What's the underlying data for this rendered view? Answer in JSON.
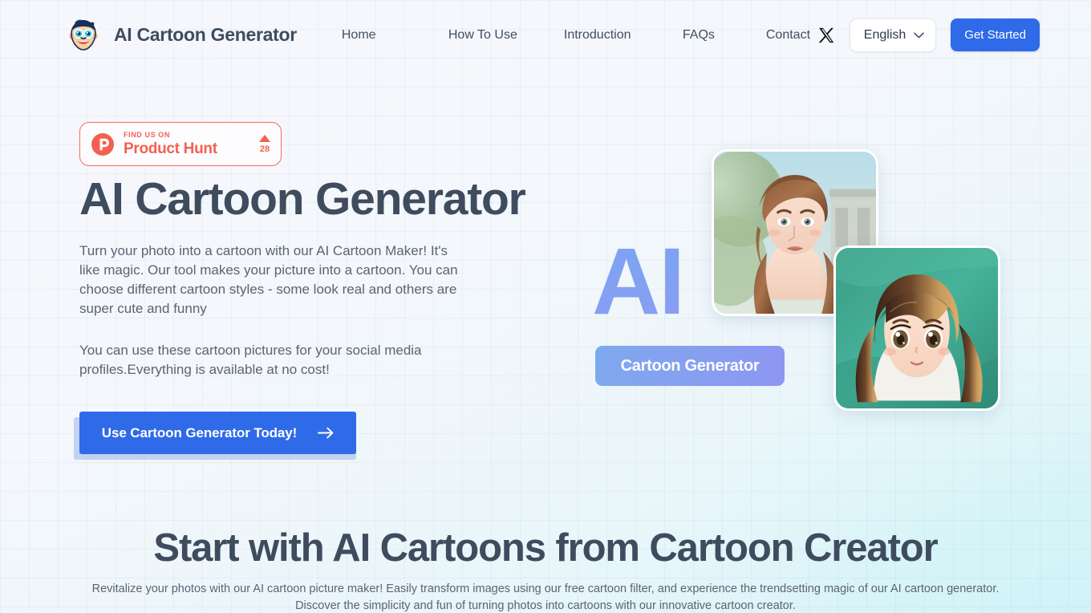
{
  "header": {
    "brand_name": "AI Cartoon Generator",
    "logo_icon": "cartoon-face-logo-icon",
    "nav": [
      {
        "label": "Home"
      },
      {
        "label": "How To Use"
      },
      {
        "label": "Introduction"
      },
      {
        "label": "FAQs"
      },
      {
        "label": "Contact"
      }
    ],
    "social_icon": "x-twitter-icon",
    "language": {
      "selected": "English",
      "chevron_icon": "chevron-down-icon"
    },
    "get_started_label": "Get Started"
  },
  "hero": {
    "product_hunt": {
      "logo_icon": "product-hunt-logo-icon",
      "find_us_on": "FIND US ON",
      "name": "Product Hunt",
      "upvote_icon": "triangle-up-icon",
      "votes": "28"
    },
    "title": "AI Cartoon Generator",
    "paragraph_1": "Turn your photo into a cartoon with our AI Cartoon Maker! It's like magic. Our tool makes your picture into a cartoon. You can choose different cartoon styles - some look real and others are super cute and funny",
    "paragraph_2": "You can use these cartoon pictures for your social media profiles.Everything is available at no cost!",
    "cta_label": "Use Cartoon Generator Today!",
    "cta_arrow_icon": "arrow-right-icon",
    "art": {
      "ai_word": "AI",
      "pill_label": "Cartoon Generator",
      "photo_a_alt": "realistic-portrait-woman-photo",
      "photo_b_alt": "anime-cartoon-girl-photo"
    }
  },
  "section2": {
    "title": "Start with AI Cartoons from Cartoon Creator",
    "subtitle_line1": "Revitalize your photos with our AI cartoon picture maker! Easily transform images using our free cartoon filter, and experience the trendsetting magic of our AI cartoon generator.",
    "subtitle_line2": "Discover the simplicity and fun of turning photos into cartoons with our innovative cartoon creator."
  },
  "colors": {
    "primary_blue": "#2f6ae8",
    "heading_slate": "#3f4c5e",
    "product_hunt_red": "#f4604f",
    "body_text": "#5b6473"
  }
}
